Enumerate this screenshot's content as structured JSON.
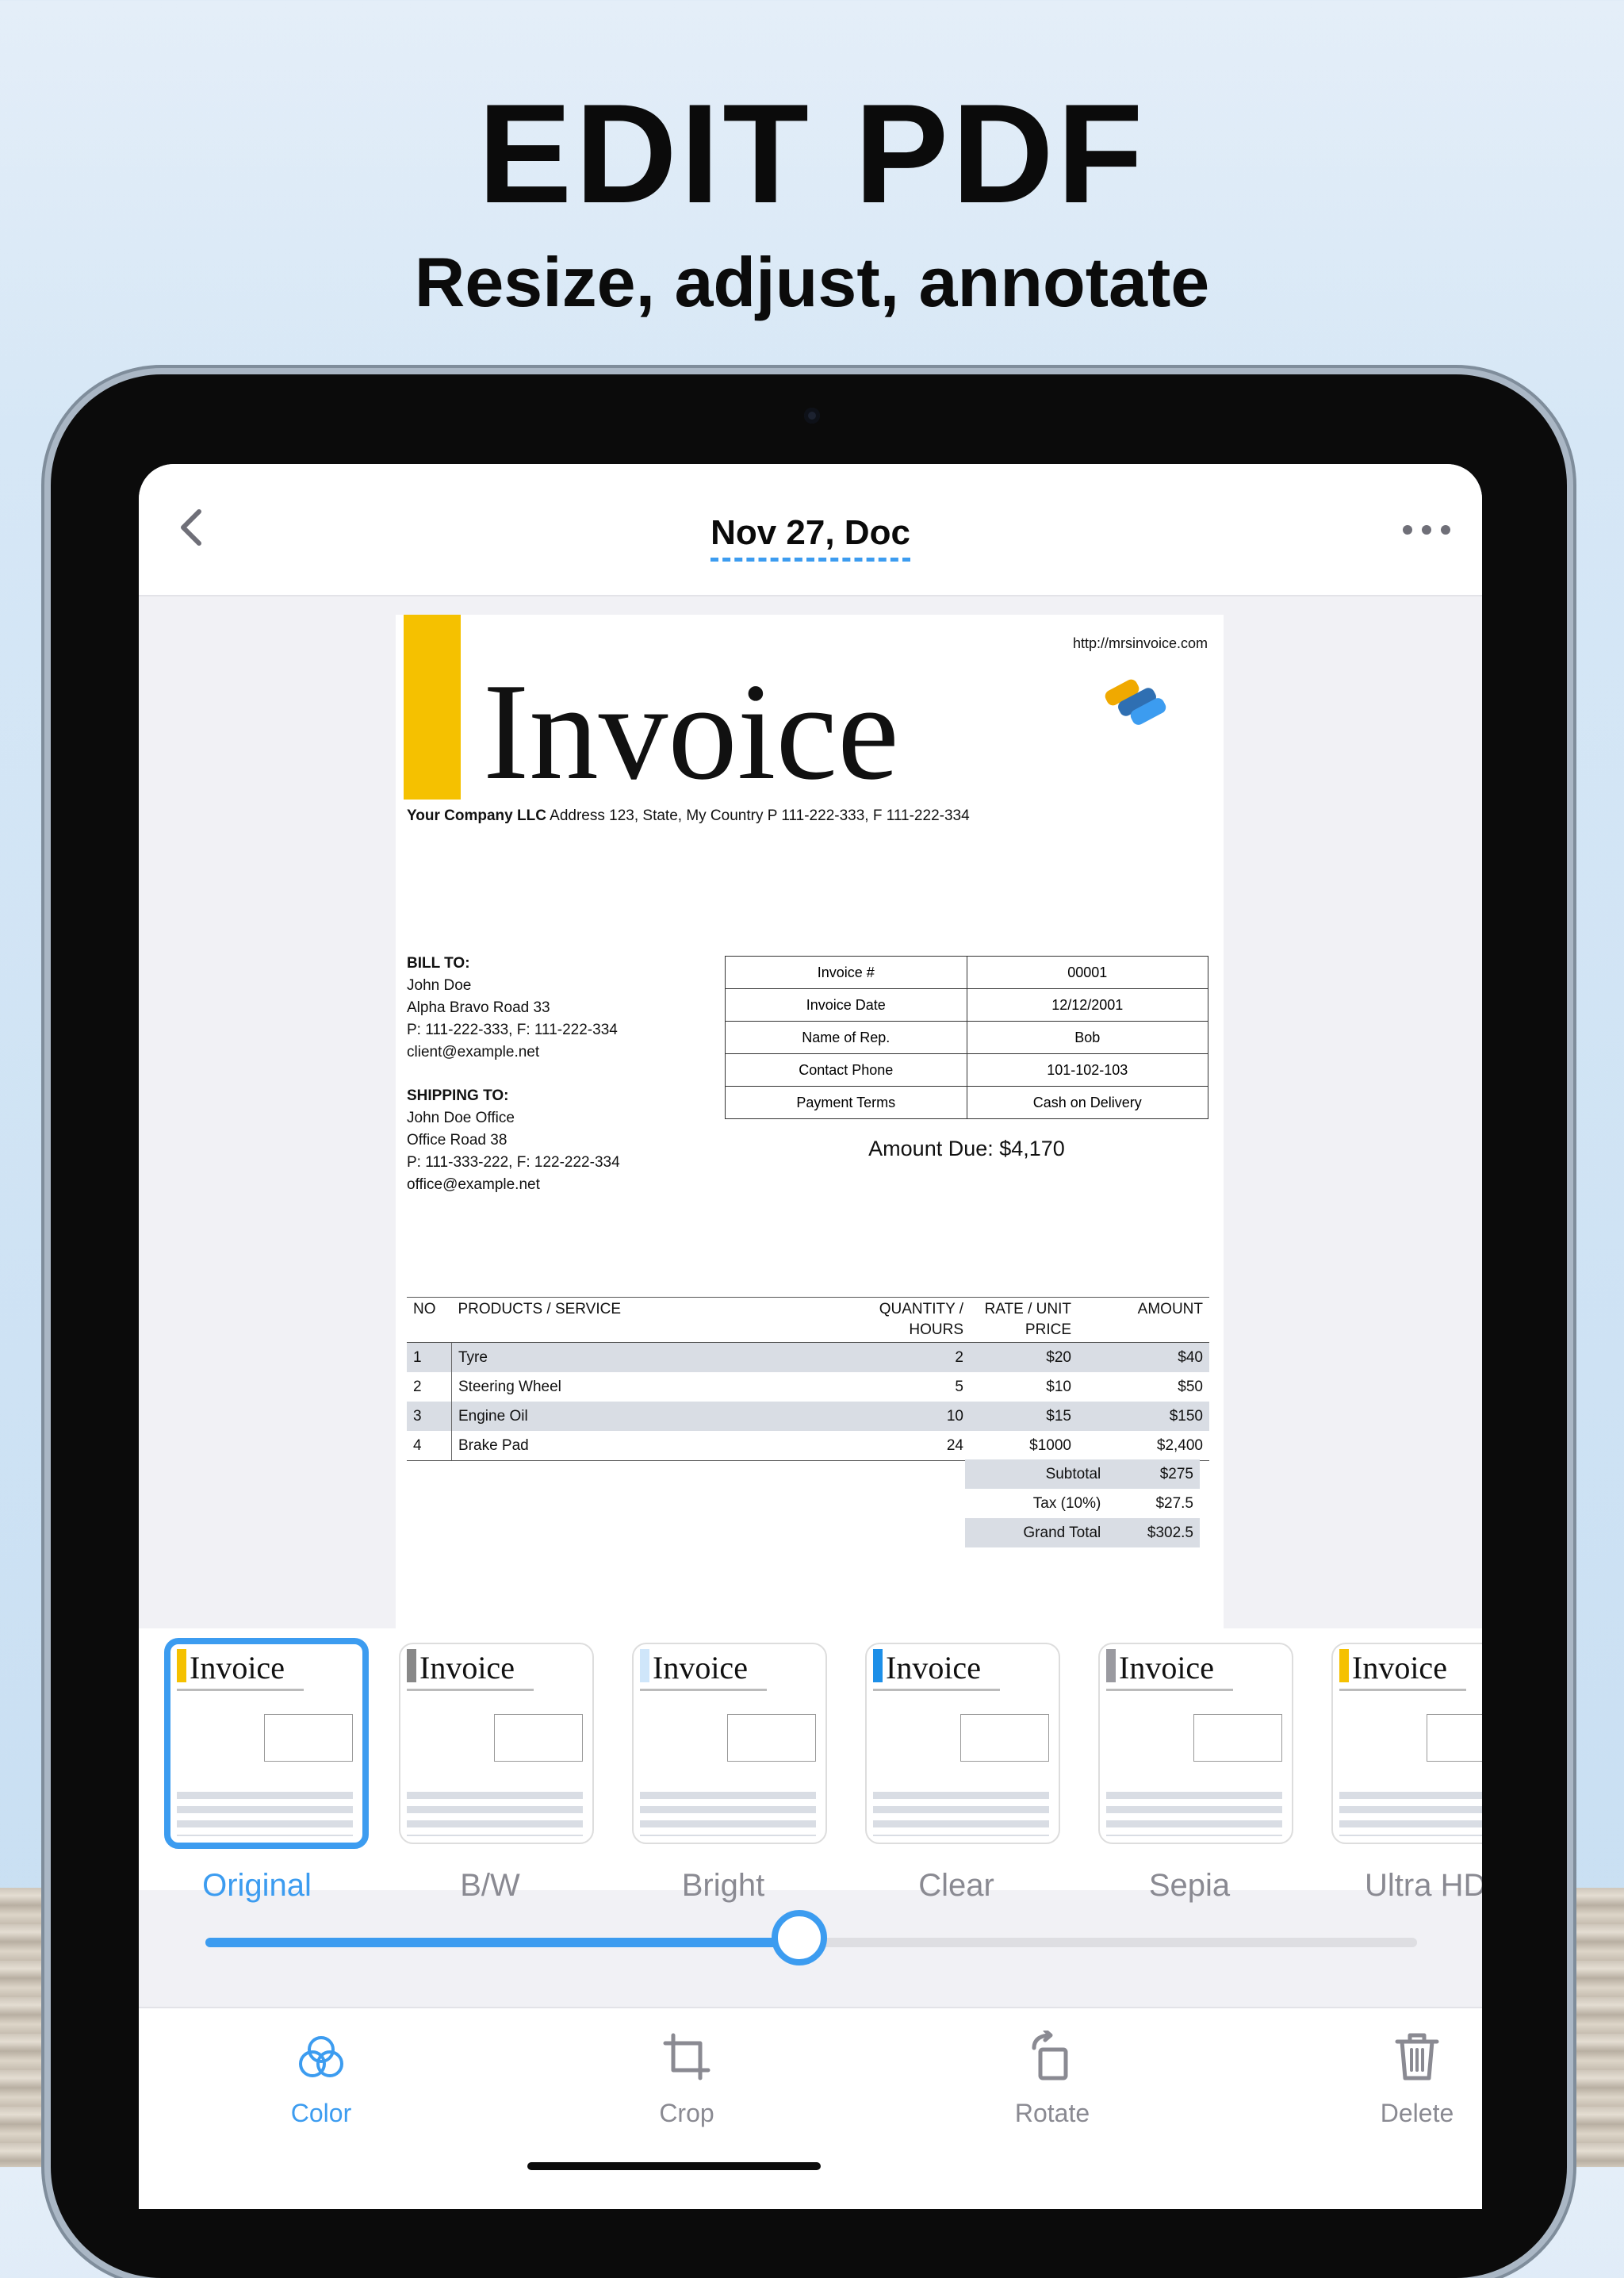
{
  "promo": {
    "headline": "EDIT PDF",
    "subhead": "Resize, adjust, annotate"
  },
  "nav": {
    "title": "Nov 27, Doc",
    "back_icon": "chevron-left-icon",
    "more_icon": "ellipsis-icon"
  },
  "document": {
    "url": "http://mrsinvoice.com",
    "title": "Invoice",
    "company_name": "Your Company LLC",
    "company_address": " Address 123, State, My Country P 111-222-333, F 111-222-334",
    "bill_to": {
      "heading": "BILL TO:",
      "lines": [
        "John Doe",
        "Alpha Bravo Road 33",
        "P: 111-222-333, F: 111-222-334",
        "client@example.net"
      ]
    },
    "ship_to": {
      "heading": "SHIPPING TO:",
      "lines": [
        "John Doe Office",
        "Office Road 38",
        "P: 111-333-222, F: 122-222-334",
        "office@example.net"
      ]
    },
    "info": [
      {
        "label": "Invoice #",
        "value": "00001"
      },
      {
        "label": "Invoice Date",
        "value": "12/12/2001"
      },
      {
        "label": "Name of Rep.",
        "value": "Bob"
      },
      {
        "label": "Contact Phone",
        "value": "101-102-103"
      },
      {
        "label": "Payment Terms",
        "value": "Cash on Delivery"
      }
    ],
    "amount_due": "Amount Due: $4,170",
    "columns": {
      "no": "NO",
      "product": "PRODUCTS / SERVICE",
      "qty_line1": "QUANTITY /",
      "qty_line2": "HOURS",
      "rate_line1": "RATE / UNIT",
      "rate_line2": "PRICE",
      "amount": "AMOUNT"
    },
    "items": [
      {
        "no": "1",
        "product": "Tyre",
        "qty": "2",
        "rate": "$20",
        "amount": "$40"
      },
      {
        "no": "2",
        "product": "Steering Wheel",
        "qty": "5",
        "rate": "$10",
        "amount": "$50"
      },
      {
        "no": "3",
        "product": "Engine Oil",
        "qty": "10",
        "rate": "$15",
        "amount": "$150"
      },
      {
        "no": "4",
        "product": "Brake Pad",
        "qty": "24",
        "rate": "$1000",
        "amount": "$2,400"
      }
    ],
    "totals": [
      {
        "label": "Subtotal",
        "value": "$275"
      },
      {
        "label": "Tax (10%)",
        "value": "$27.5"
      },
      {
        "label": "Grand Total",
        "value": "$302.5"
      }
    ]
  },
  "filters": {
    "selected": "Original",
    "items": [
      {
        "label": "Original",
        "thumb_title": "Invoice"
      },
      {
        "label": "B/W",
        "thumb_title": "Invoice"
      },
      {
        "label": "Bright",
        "thumb_title": "Invoice"
      },
      {
        "label": "Clear",
        "thumb_title": "Invoice"
      },
      {
        "label": "Sepia",
        "thumb_title": "Invoice"
      },
      {
        "label": "Ultra HD",
        "thumb_title": "Invoice"
      }
    ]
  },
  "slider": {
    "value_fraction": 0.49
  },
  "toolbar": {
    "color": {
      "label": "Color",
      "icon": "color-circles-icon"
    },
    "crop": {
      "label": "Crop",
      "icon": "crop-icon"
    },
    "rotate": {
      "label": "Rotate",
      "icon": "rotate-icon"
    },
    "delete": {
      "label": "Delete",
      "icon": "trash-icon"
    }
  },
  "colors": {
    "accent": "#3c9cf0",
    "inactive": "#8a8a92",
    "invoice_yellow": "#f5c100"
  }
}
